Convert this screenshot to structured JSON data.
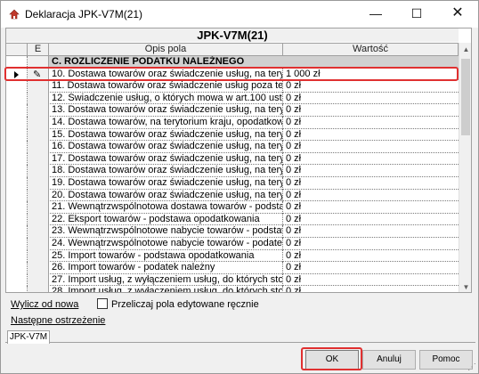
{
  "window": {
    "title": "Deklaracja JPK-V7M(21)",
    "min_glyph": "—",
    "max_glyph": "☐",
    "close_glyph": "✕"
  },
  "grid": {
    "title": "JPK-V7M(21)",
    "headers": {
      "e": "E",
      "opis": "Opis pola",
      "wartosc": "Wartość"
    },
    "rows": [
      {
        "opis": "C. ROZLICZENIE PODATKU NALEŻNEGO",
        "wartosc": "",
        "section": true
      },
      {
        "opis": "10. Dostawa towarów oraz świadczenie usług, na terytoriu",
        "wartosc": "1 000 zł",
        "current": true
      },
      {
        "opis": "11. Dostawa towarów oraz świadczenie usług poza terytor",
        "wartosc": "0 zł"
      },
      {
        "opis": "12. Świadczenie usług, o których mowa w art.100 ust.1 p",
        "wartosc": "0 zł"
      },
      {
        "opis": "13. Dostawa towarów oraz świadczenie usług, na terytoriu",
        "wartosc": "0 zł"
      },
      {
        "opis": "14. Dostawa towarów, na terytorium kraju, opodatkowana",
        "wartosc": "0 zł"
      },
      {
        "opis": "15. Dostawa towarów oraz świadczenie usług, na terytoriu",
        "wartosc": "0 zł"
      },
      {
        "opis": "16. Dostawa towarów oraz świadczenie usług, na terytoriu",
        "wartosc": "0 zł"
      },
      {
        "opis": "17. Dostawa towarów oraz świadczenie usług, na terytoriu",
        "wartosc": "0 zł"
      },
      {
        "opis": "18. Dostawa towarów oraz świadczenie usług, na terytoriu",
        "wartosc": "0 zł"
      },
      {
        "opis": "19. Dostawa towarów oraz świadczenie usług, na terytoriu",
        "wartosc": "0 zł"
      },
      {
        "opis": "20. Dostawa towarów oraz świadczenie usług, na terytoriu",
        "wartosc": "0 zł"
      },
      {
        "opis": "21. Wewnątrzwspólnotowa dostawa towarów - podstawa o",
        "wartosc": "0 zł"
      },
      {
        "opis": "22. Eksport towarów - podstawa opodatkowania",
        "wartosc": "0 zł"
      },
      {
        "opis": "23. Wewnątrzwspólnotowe nabycie towarów - podstawa o",
        "wartosc": "0 zł"
      },
      {
        "opis": "24. Wewnątrzwspólnotowe nabycie towarów - podatek nal",
        "wartosc": "0 zł"
      },
      {
        "opis": "25. Import towarów - podstawa opodatkowania",
        "wartosc": "0 zł"
      },
      {
        "opis": "26. Import towarów - podatek należny",
        "wartosc": "0 zł"
      },
      {
        "opis": "27. Import usług, z wyłączeniem usług, do których stosuj",
        "wartosc": "0 zł"
      },
      {
        "opis": "28. Import usług, z wyłączeniem usług, do których stosuj",
        "wartosc": "0 zł"
      }
    ]
  },
  "controls": {
    "wylicz": "Wylicz od nowa",
    "przeliczaj": "Przeliczaj pola edytowane ręcznie",
    "nastepne": "Następne ostrzeżenie"
  },
  "tabs": [
    "JPK-V7M"
  ],
  "buttons": {
    "ok": "OK",
    "cancel": "Anuluj",
    "help": "Pomoc"
  },
  "colors": {
    "highlight": "#e03030",
    "section_bg": "#d0d0d0"
  }
}
